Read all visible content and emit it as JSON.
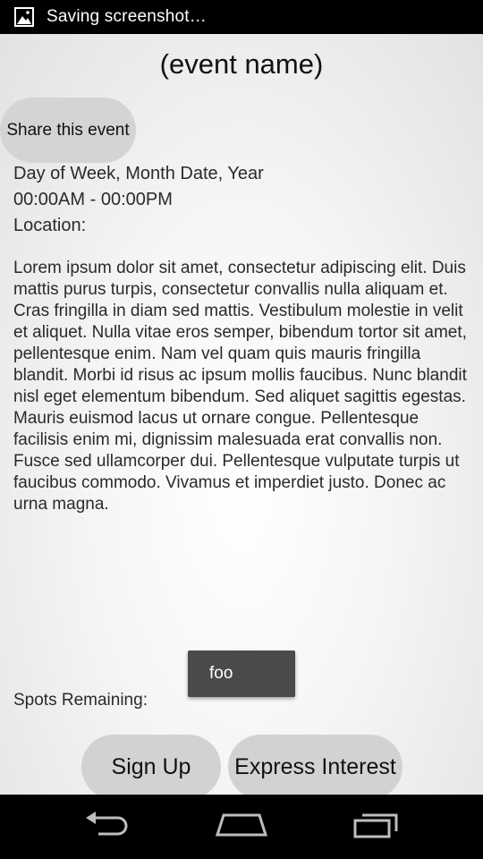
{
  "status_bar": {
    "notification_icon": "image-icon",
    "text": "Saving screenshot…"
  },
  "event": {
    "title": "(event name)",
    "share_label": "Share this event",
    "date": "Day of Week, Month Date, Year",
    "time": "00:00AM - 00:00PM",
    "location_label": "Location:",
    "description": "Lorem ipsum dolor sit amet, consectetur adipiscing elit. Duis mattis purus turpis, consectetur convallis nulla aliquam et. Cras fringilla in diam sed mattis. Vestibulum molestie in velit et aliquet. Nulla vitae eros semper, bibendum tortor sit amet, pellentesque enim. Nam vel quam quis mauris fringilla blandit. Morbi id risus ac ipsum mollis faucibus. Nunc blandit nisl eget elementum bibendum. Sed aliquet sagittis egestas. Mauris euismod lacus ut ornare congue. Pellentesque facilisis enim mi, dignissim malesuada erat convallis non. Fusce sed ullamcorper dui. Pellentesque vulputate turpis ut faucibus commodo. Vivamus et imperdiet justo. Donec ac urna magna.",
    "spots_label": "Spots Remaining:"
  },
  "toast": {
    "text": "foo"
  },
  "actions": {
    "sign_up_label": "Sign Up",
    "express_interest_label": "Express Interest"
  },
  "nav_bar": {
    "back_icon": "back-icon",
    "home_icon": "home-icon",
    "recents_icon": "recents-icon"
  }
}
